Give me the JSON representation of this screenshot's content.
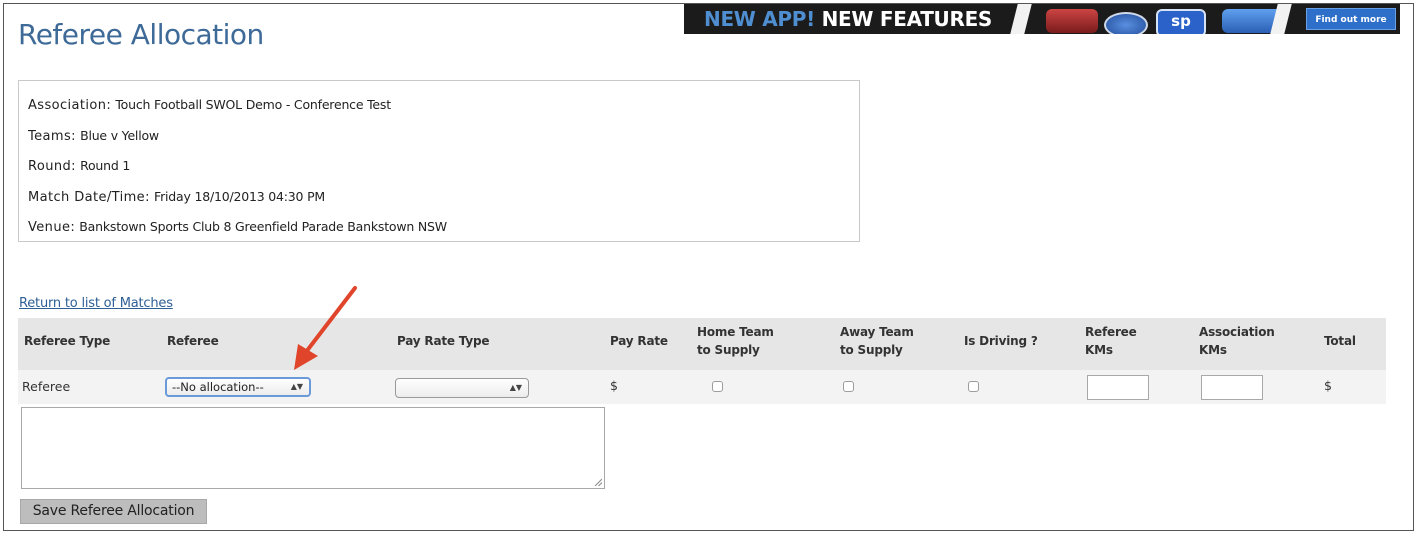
{
  "page": {
    "title": "Referee Allocation"
  },
  "banner": {
    "text_highlight": "NEW APP!",
    "text_main": " NEW FEATURES",
    "button_label": "Find out more",
    "colors": {
      "background": "#1b1b1b",
      "highlight": "#4f8fd1",
      "button": "#2e6fc9"
    }
  },
  "match_info": {
    "association_label": "Association:",
    "association_value": "Touch Football SWOL Demo - Conference Test",
    "teams_label": "Teams:",
    "teams_value": "Blue v Yellow",
    "round_label": "Round:",
    "round_value": "Round 1",
    "datetime_label": "Match Date/Time:",
    "datetime_value": "Friday 18/10/2013 04:30 PM",
    "venue_label": "Venue:",
    "venue_value": "Bankstown Sports Club 8 Greenfield Parade Bankstown NSW"
  },
  "return_link": "Return to list of Matches",
  "table": {
    "headers": {
      "referee_type": "Referee Type",
      "referee": "Referee",
      "pay_rate_type": "Pay Rate Type",
      "pay_rate": "Pay Rate",
      "home_team_1": "Home Team",
      "home_team_2": "to Supply",
      "away_team_1": "Away Team",
      "away_team_2": "to Supply",
      "is_driving": "Is Driving ?",
      "referee_kms_1": "Referee",
      "referee_kms_2": "KMs",
      "association_kms_1": "Association",
      "association_kms_2": "KMs",
      "total": "Total"
    },
    "row": {
      "referee_type": "Referee",
      "referee_select": "--No allocation--",
      "pay_rate_type_select": "",
      "pay_rate": "$",
      "home_team_supply": false,
      "away_team_supply": false,
      "is_driving": false,
      "referee_kms": "",
      "association_kms": "",
      "total": "$"
    }
  },
  "notes_value": "",
  "save_button": "Save Referee Allocation",
  "colors": {
    "title": "#3e6a98",
    "link": "#2d5f96",
    "header_bg": "#e6e6e6",
    "row_bg": "#f3f3f3",
    "annotation_arrow": "#e0452b"
  }
}
